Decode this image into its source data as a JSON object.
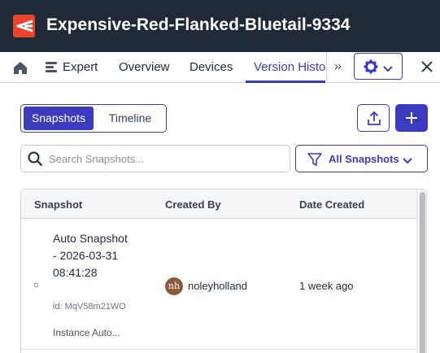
{
  "app": {
    "title": "Expensive-Red-Flanked-Bluetail-9334",
    "accent": "#3b3bbf",
    "brand": "#e8452b"
  },
  "tabs": [
    {
      "label": "Expert"
    },
    {
      "label": "Overview"
    },
    {
      "label": "Devices"
    },
    {
      "label": "Version History",
      "active": true
    }
  ],
  "overflow": {
    "label": "››"
  },
  "segments": {
    "active": "Snapshots",
    "other": "Timeline"
  },
  "search": {
    "placeholder": "Search Snapshots...",
    "value": ""
  },
  "filter": {
    "label": "All Snapshots"
  },
  "table": {
    "columns": [
      "Snapshot",
      "Created By",
      "Date Created"
    ],
    "rows": [
      {
        "name": "Auto Snapshot - 2026-03-31 08:41:28",
        "id": "id: MqV58m21WO",
        "description": "Instance Auto...",
        "avatar": "nh",
        "created_by": "noleyholland",
        "date": "1 week ago"
      }
    ]
  }
}
